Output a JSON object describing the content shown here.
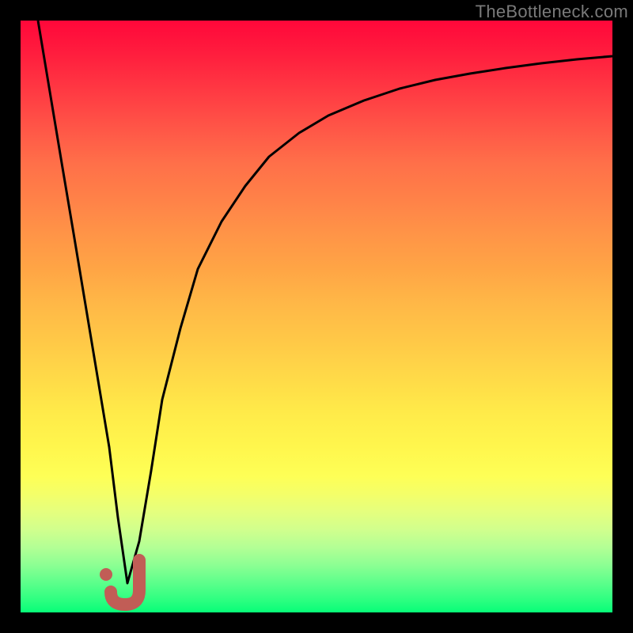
{
  "watermark": "TheBottleneck.com",
  "colors": {
    "frame": "#000000",
    "curve": "#000000",
    "marker_fill": "#c15d56",
    "marker_stroke": "#c15d56"
  },
  "chart_data": {
    "type": "line",
    "title": "",
    "xlabel": "",
    "ylabel": "",
    "xlim": [
      0,
      100
    ],
    "ylim": [
      0,
      100
    ],
    "grid": false,
    "legend": false,
    "series": [
      {
        "name": "bottleneck-curve",
        "x": [
          3,
          5,
          7,
          9,
          11,
          13,
          15,
          16.5,
          18,
          20,
          22,
          24,
          27,
          30,
          34,
          38,
          42,
          47,
          52,
          58,
          64,
          70,
          76,
          82,
          88,
          94,
          100
        ],
        "y": [
          100,
          88,
          76,
          64,
          52,
          40,
          28,
          16,
          5,
          12,
          24,
          36,
          48,
          58,
          66,
          72,
          77,
          81,
          84,
          86.5,
          88.5,
          90,
          91,
          92,
          92.8,
          93.4,
          94
        ],
        "note": "V-shaped curve that descends steeply to a minimum near x≈17 then rises asymptotically toward ~94%."
      }
    ],
    "marker": {
      "name": "selected-point",
      "shape": "J",
      "x": 18.5,
      "y": 3,
      "dot": {
        "x": 15.5,
        "y": 6
      }
    }
  }
}
